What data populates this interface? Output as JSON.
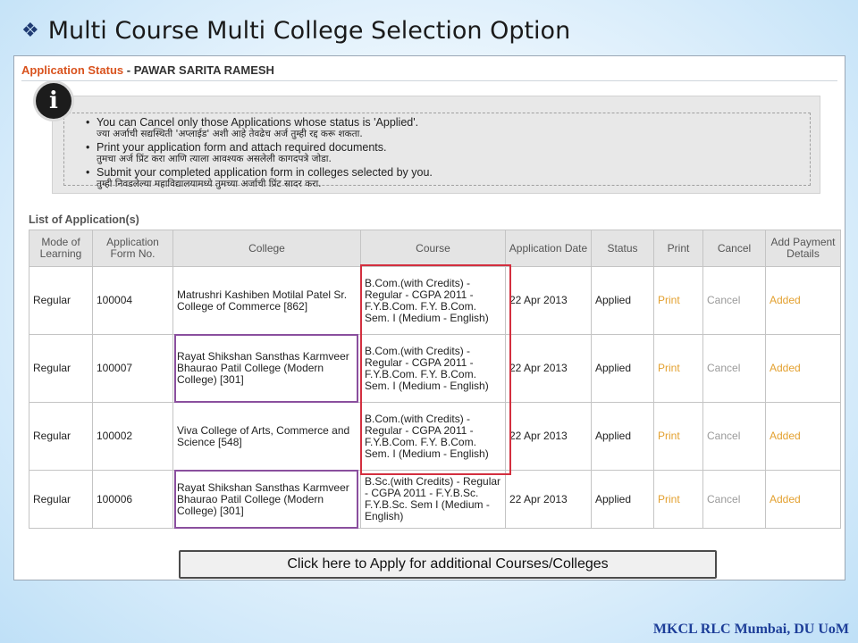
{
  "slide": {
    "title": "Multi Course Multi College Selection Option",
    "footer": "MKCL RLC Mumbai, DU UoM"
  },
  "app": {
    "status_label": "Application Status",
    "separator": "-",
    "applicant_name": "PAWAR SARITA RAMESH",
    "info_icon_glyph": "i",
    "info_items": [
      {
        "en": "You can Cancel only those Applications whose status is 'Applied'.",
        "mr": "ज्या अर्जाची सद्यस्थिती 'अप्लाईड' अशी आहे तेवढेच अर्ज तुम्ही रद्द करू शकता."
      },
      {
        "en": "Print your application form and attach required documents.",
        "mr": "तुमचा अर्ज प्रिंट करा आणि त्याला आवश्यक असलेली कागदपत्रे जोडा."
      },
      {
        "en": "Submit your completed application form in colleges selected by you.",
        "mr": "तुम्ही निवडलेल्या महाविद्यालयामध्ये तुमच्या अर्जाची प्रिंट सादर करा."
      }
    ],
    "list_title": "List of Application(s)",
    "columns": [
      "Mode of Learning",
      "Application Form No.",
      "College",
      "Course",
      "Application Date",
      "Status",
      "Print",
      "Cancel",
      "Add Payment Details"
    ],
    "rows": [
      {
        "mode": "Regular",
        "form_no": "100004",
        "college": "Matrushri Kashiben Motilal Patel Sr. College of Commerce [862]",
        "course": "B.Com.(with Credits) - Regular - CGPA 2011 - F.Y.B.Com. F.Y. B.Com. Sem. I (Medium - English)",
        "date": "22 Apr 2013",
        "status": "Applied",
        "print": "Print",
        "cancel": "Cancel",
        "payment": "Added"
      },
      {
        "mode": "Regular",
        "form_no": "100007",
        "college": "Rayat Shikshan Sansthas Karmveer Bhaurao Patil College (Modern College) [301]",
        "course": "B.Com.(with Credits) - Regular - CGPA 2011 - F.Y.B.Com. F.Y. B.Com. Sem. I (Medium - English)",
        "date": "22 Apr 2013",
        "status": "Applied",
        "print": "Print",
        "cancel": "Cancel",
        "payment": "Added"
      },
      {
        "mode": "Regular",
        "form_no": "100002",
        "college": "Viva College of Arts, Commerce and Science [548]",
        "course": "B.Com.(with Credits) - Regular - CGPA 2011 - F.Y.B.Com. F.Y. B.Com. Sem. I (Medium - English)",
        "date": "22 Apr 2013",
        "status": "Applied",
        "print": "Print",
        "cancel": "Cancel",
        "payment": "Added"
      },
      {
        "mode": "Regular",
        "form_no": "100006",
        "college": "Rayat Shikshan Sansthas Karmveer Bhaurao Patil College (Modern College) [301]",
        "course": "B.Sc.(with Credits) - Regular - CGPA 2011 - F.Y.B.Sc. F.Y.B.Sc. Sem I (Medium - English)",
        "date": "22 Apr 2013",
        "status": "Applied",
        "print": "Print",
        "cancel": "Cancel",
        "payment": "Added"
      }
    ],
    "apply_button_label": "Click here to Apply for additional Courses/Colleges"
  },
  "colors": {
    "status_label": "#d9531e",
    "link_orange": "#e3a02f",
    "highlight_course": "#d32f3f",
    "highlight_college": "#8a4f9e",
    "footer": "#1e3f99"
  }
}
